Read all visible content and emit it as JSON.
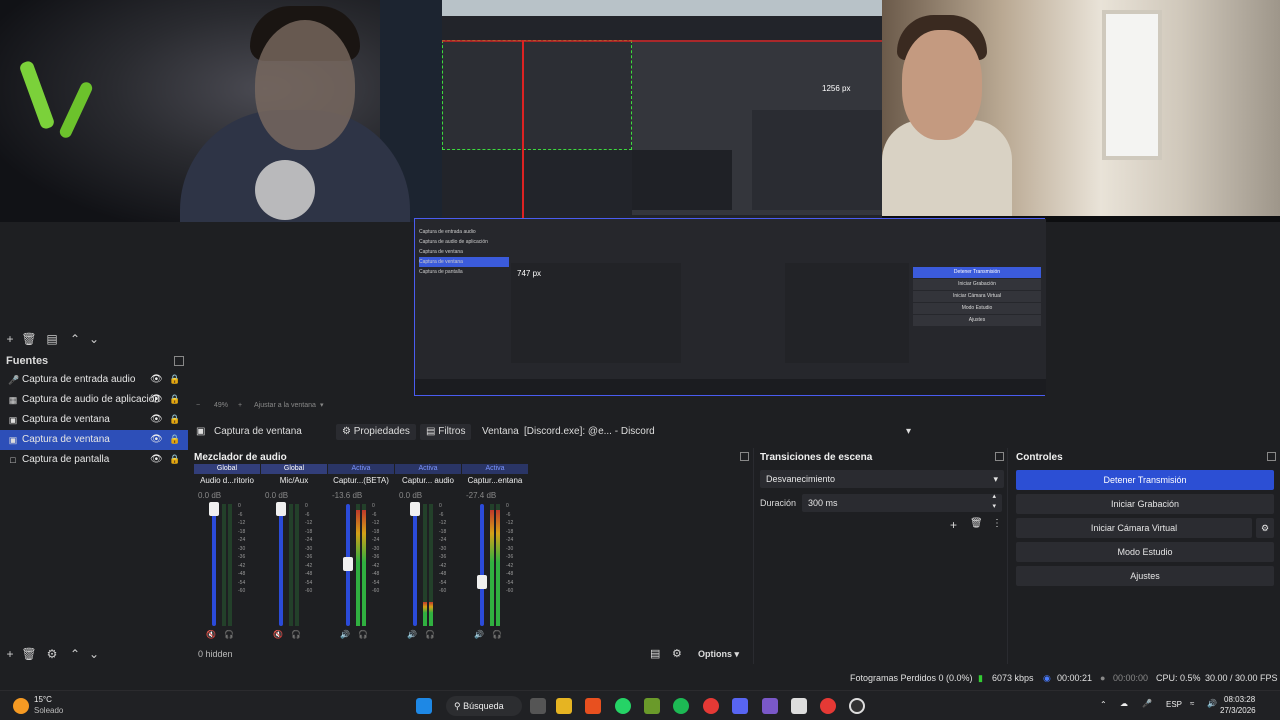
{
  "preview": {
    "measure_label_1": "1256 px",
    "measure_label_2": "747 px"
  },
  "nested_obs": {
    "sources": [
      "Captura de entrada audio",
      "Captura de audio de aplicación",
      "Captura de ventana",
      "Captura de ventana",
      "Captura de pantalla"
    ],
    "controls": [
      "Detener Transmisión",
      "Iniciar Grabación",
      "Iniciar Cámara Virtual",
      "Modo Estudio",
      "Ajustes"
    ]
  },
  "sources": {
    "title": "Fuentes",
    "items": [
      {
        "label": "Captura de entrada audio",
        "icon": "microphone-icon",
        "selected": false
      },
      {
        "label": "Captura de audio de aplicación",
        "icon": "app-audio-icon",
        "selected": false
      },
      {
        "label": "Captura de ventana",
        "icon": "window-icon",
        "selected": false
      },
      {
        "label": "Captura de ventana",
        "icon": "window-icon",
        "selected": true
      },
      {
        "label": "Captura de pantalla",
        "icon": "monitor-icon",
        "selected": false
      }
    ]
  },
  "zoom": {
    "level": "49%",
    "fit_label": "Ajustar a la ventana"
  },
  "context": {
    "source_name": "Captura de ventana",
    "properties_label": "Propiedades",
    "filters_label": "Filtros",
    "window_label": "Ventana",
    "window_value": "[Discord.exe]: @e... - Discord"
  },
  "mixer": {
    "title": "Mezclador de audio",
    "hidden_label": "0 hidden",
    "options_label": "Options",
    "scale": [
      "0",
      "-6",
      "-12",
      "-18",
      "-24",
      "-30",
      "-36",
      "-42",
      "-48",
      "-54",
      "-60"
    ],
    "channels": [
      {
        "scope": "Global",
        "name": "Audio d...ritorio",
        "db": "0.0 dB",
        "level": 1.0,
        "meter": 0.0,
        "muted": true
      },
      {
        "scope": "Global",
        "name": "Mic/Aux",
        "db": "0.0 dB",
        "level": 1.0,
        "meter": 0.0,
        "muted": true
      },
      {
        "scope": "Activa",
        "name": "Captur...(BETA)",
        "db": "-13.6 dB",
        "level": 0.55,
        "meter": 0.95,
        "muted": false
      },
      {
        "scope": "Activa",
        "name": "Captur... audio",
        "db": "0.0 dB",
        "level": 1.0,
        "meter": 0.2,
        "muted": false
      },
      {
        "scope": "Activa",
        "name": "Captur...entana",
        "db": "-27.4 dB",
        "level": 0.4,
        "meter": 0.95,
        "muted": false
      }
    ]
  },
  "transitions": {
    "title": "Transiciones de escena",
    "selected": "Desvanecimiento",
    "duration_label": "Duración",
    "duration_value": "300 ms"
  },
  "controls": {
    "title": "Controles",
    "buttons": [
      "Detener Transmisión",
      "Iniciar Grabación",
      "Iniciar Cámara Virtual",
      "Modo Estudio",
      "Ajustes"
    ]
  },
  "status": {
    "dropped": "Fotogramas Perdidos 0 (0.0%)",
    "bitrate": "6073 kbps",
    "stream_time": "00:00:21",
    "rec_time": "00:00:00",
    "cpu": "CPU: 0.5%",
    "fps": "30.00 / 30.00 FPS"
  },
  "taskbar": {
    "weather_temp": "15°C",
    "weather_desc": "Soleado",
    "search_label": "Búsqueda",
    "lang": "ESP",
    "time": "08:03:28",
    "date": "27/3/2026"
  },
  "colors": {
    "accent": "#2c4fd4",
    "bg": "#1e1f22",
    "panel": "#2a2b30"
  }
}
